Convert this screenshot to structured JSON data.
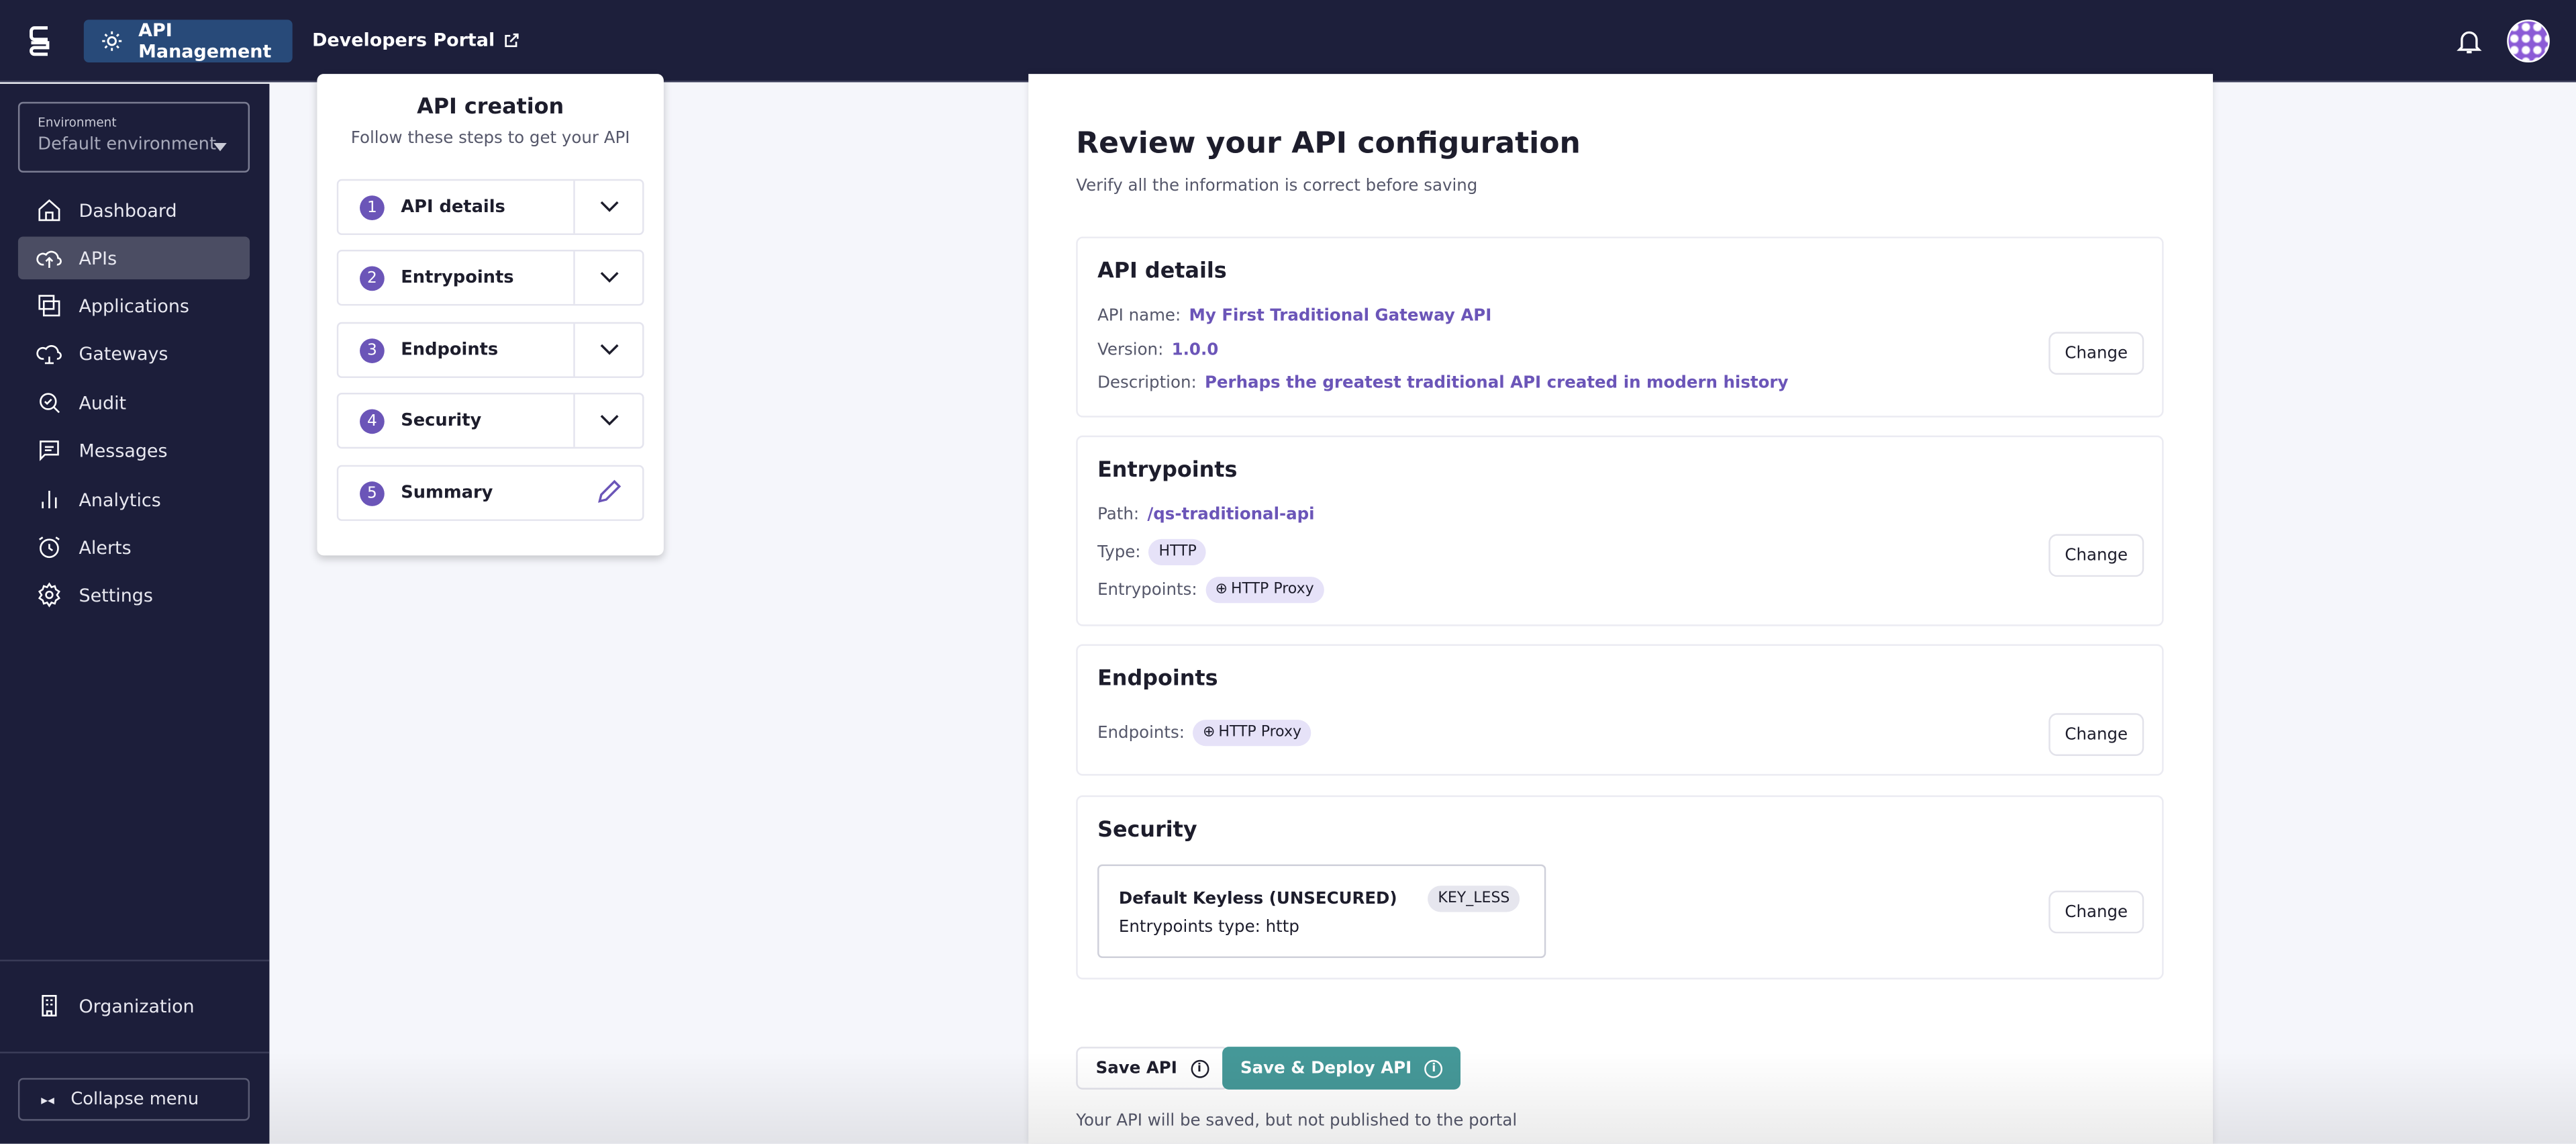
{
  "topbar": {
    "api_management": "API Management",
    "developers_portal": "Developers Portal"
  },
  "sidebar": {
    "environment_label": "Environment",
    "environment_value": "Default environment",
    "items": [
      {
        "label": "Dashboard",
        "icon": "home-icon"
      },
      {
        "label": "APIs",
        "icon": "cloud-upload-icon",
        "active": true
      },
      {
        "label": "Applications",
        "icon": "applications-icon"
      },
      {
        "label": "Gateways",
        "icon": "cloud-gateway-icon"
      },
      {
        "label": "Audit",
        "icon": "audit-search-icon"
      },
      {
        "label": "Messages",
        "icon": "message-icon"
      },
      {
        "label": "Analytics",
        "icon": "bar-chart-icon"
      },
      {
        "label": "Alerts",
        "icon": "alarm-clock-icon"
      },
      {
        "label": "Settings",
        "icon": "gear-icon"
      }
    ],
    "organization": "Organization",
    "collapse": "Collapse menu"
  },
  "stepper": {
    "title": "API creation",
    "subtitle": "Follow these steps to get your API",
    "steps": [
      {
        "num": "1",
        "label": "API details"
      },
      {
        "num": "2",
        "label": "Entrypoints"
      },
      {
        "num": "3",
        "label": "Endpoints"
      },
      {
        "num": "4",
        "label": "Security"
      },
      {
        "num": "5",
        "label": "Summary"
      }
    ]
  },
  "review": {
    "title": "Review your API configuration",
    "subtitle": "Verify all the information is correct before saving",
    "change_label": "Change",
    "api_details": {
      "title": "API details",
      "name_label": "API name:",
      "name": "My First Traditional Gateway API",
      "version_label": "Version:",
      "version": "1.0.0",
      "description_label": "Description:",
      "description": "Perhaps the greatest traditional API created in modern history"
    },
    "entrypoints": {
      "title": "Entrypoints",
      "path_label": "Path:",
      "path": "/qs-traditional-api",
      "type_label": "Type:",
      "type": "HTTP",
      "entrypoints_label": "Entrypoints:",
      "entrypoint": "HTTP Proxy"
    },
    "endpoints": {
      "title": "Endpoints",
      "endpoints_label": "Endpoints:",
      "endpoint": "HTTP Proxy"
    },
    "security": {
      "title": "Security",
      "plan_name": "Default Keyless (UNSECURED)",
      "plan_type": "KEY_LESS",
      "entrypoints_type": "Entrypoints type: http"
    },
    "save": "Save API",
    "deploy": "Save & Deploy API",
    "footer": "Your API will be saved, but not published to the portal"
  },
  "colors": {
    "topbar": "#1d1f3b",
    "accent": "#6b55b8",
    "deploy": "#459898"
  }
}
